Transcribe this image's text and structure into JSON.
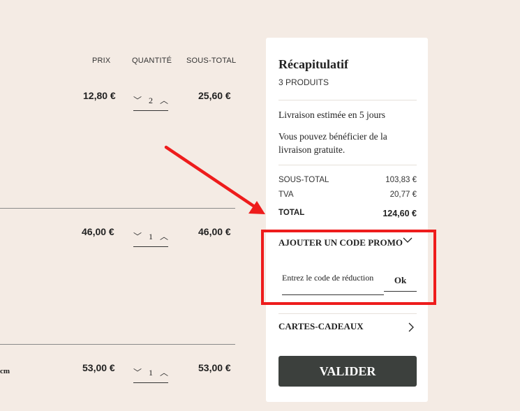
{
  "table": {
    "headers": {
      "price": "PRIX",
      "quantity": "QUANTITÉ",
      "subtotal": "SOUS-TOTAL"
    },
    "rows": [
      {
        "price": "12,80 €",
        "quantity": "2",
        "subtotal": "25,60 €"
      },
      {
        "price": "46,00 €",
        "quantity": "1",
        "subtotal": "46,00 €"
      },
      {
        "price": "53,00 €",
        "quantity": "1",
        "subtotal": "53,00 €"
      }
    ],
    "partial_text": "cm"
  },
  "summary": {
    "title": "Récapitulatif",
    "count": "3 PRODUITS",
    "delivery_estimate": "Livraison estimée en 5 jours",
    "free_delivery": "Vous pouvez bénéficier de la livraison gratuite.",
    "lines": [
      {
        "label": "SOUS-TOTAL",
        "value": "103,83 €"
      },
      {
        "label": "TVA",
        "value": "20,77 €"
      },
      {
        "label": "TOTAL",
        "value": "124,60 €"
      }
    ],
    "promo": {
      "heading": "AJOUTER UN CODE PROMO",
      "placeholder": "Entrez le code de réduction",
      "ok_label": "Ok"
    },
    "gift_cards": "CARTES-CADEAUX",
    "validate_label": "VALIDER"
  },
  "colors": {
    "page_bg": "#f4ebe4",
    "validate_bg": "#3c403d",
    "annotation": "#ee1c1c"
  }
}
